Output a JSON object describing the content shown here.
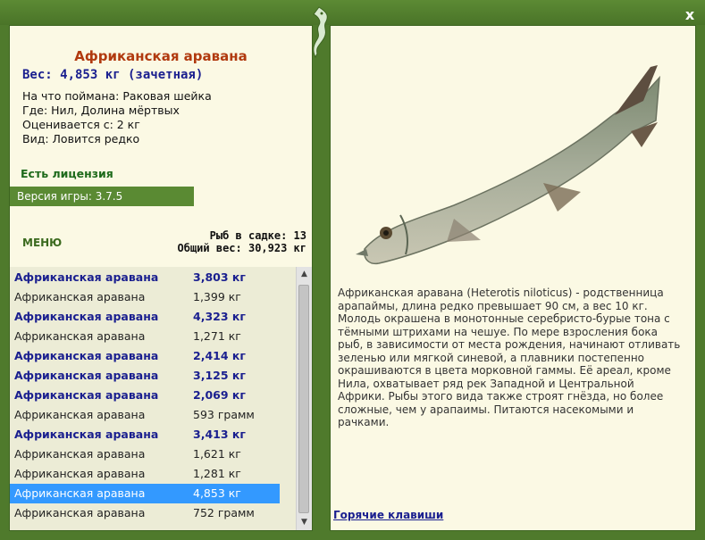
{
  "window": {
    "close_label": "x"
  },
  "fish": {
    "title": "Африканская аравана",
    "weight": "Вес: 4,853 кг (зачетная)",
    "caught_on": "На что поймана: Раковая шейка",
    "location": "Где: Нил, Долина мёртвых",
    "value": "Оценивается с: 2 кг",
    "rarity": "Вид: Ловится редко"
  },
  "license": "Есть лицензия",
  "version": "Версия игры: 3.7.5",
  "menu_label": "МЕНЮ",
  "stats": {
    "fish_in_net": "Рыб в садке: 13",
    "total_weight": "Общий вес: 30,923 кг"
  },
  "catch_list": [
    {
      "name": "Африканская аравана",
      "weight": "3,803 кг",
      "style": "big"
    },
    {
      "name": "Африканская аравана",
      "weight": "1,399 кг",
      "style": "norm"
    },
    {
      "name": "Африканская аравана",
      "weight": "4,323 кг",
      "style": "big"
    },
    {
      "name": "Африканская аравана",
      "weight": "1,271 кг",
      "style": "norm"
    },
    {
      "name": "Африканская аравана",
      "weight": "2,414 кг",
      "style": "big"
    },
    {
      "name": "Африканская аравана",
      "weight": "3,125 кг",
      "style": "big"
    },
    {
      "name": "Африканская аравана",
      "weight": "2,069 кг",
      "style": "big"
    },
    {
      "name": "Африканская аравана",
      "weight": "593 грамм",
      "style": "norm"
    },
    {
      "name": "Африканская аравана",
      "weight": "3,413 кг",
      "style": "big"
    },
    {
      "name": "Африканская аравана",
      "weight": "1,621 кг",
      "style": "norm"
    },
    {
      "name": "Африканская аравана",
      "weight": "1,281 кг",
      "style": "norm"
    },
    {
      "name": "Африканская аравана",
      "weight": "4,853 кг",
      "style": "sel"
    },
    {
      "name": "Африканская аравана",
      "weight": "752 грамм",
      "style": "norm"
    }
  ],
  "description": "Африканская аравана (Heterotis niloticus) - родственница арапаймы, длина редко превышает 90 см, а вес 10 кг. Молодь окрашена в монотонные серебристо-бурые тона с тёмными штрихами на чешуе. По мере взросления бока рыб, в зависимости от места рождения, начинают отливать зеленью или мягкой синевой, а плавники постепенно окрашиваются в цвета морковной гаммы. Её ареал, кроме Нила, охватывает ряд рек Западной и Центральной Африки. Рыбы этого вида также строят гнёзда, но более сложные, чем у арапаимы. Питаются насекомыми и рачками.",
  "hotkeys_label": "Горячие клавиши",
  "icons": {
    "close": "close-icon",
    "logo": "dragon-logo-icon",
    "scroll_up": "arrow-up-icon",
    "scroll_down": "arrow-down-icon"
  },
  "colors": {
    "frame": "#4f7a2c",
    "panel": "#fbf9e4",
    "title": "#b13a0f",
    "big_catch": "#1a1f8f",
    "selection": "#3399ff"
  }
}
